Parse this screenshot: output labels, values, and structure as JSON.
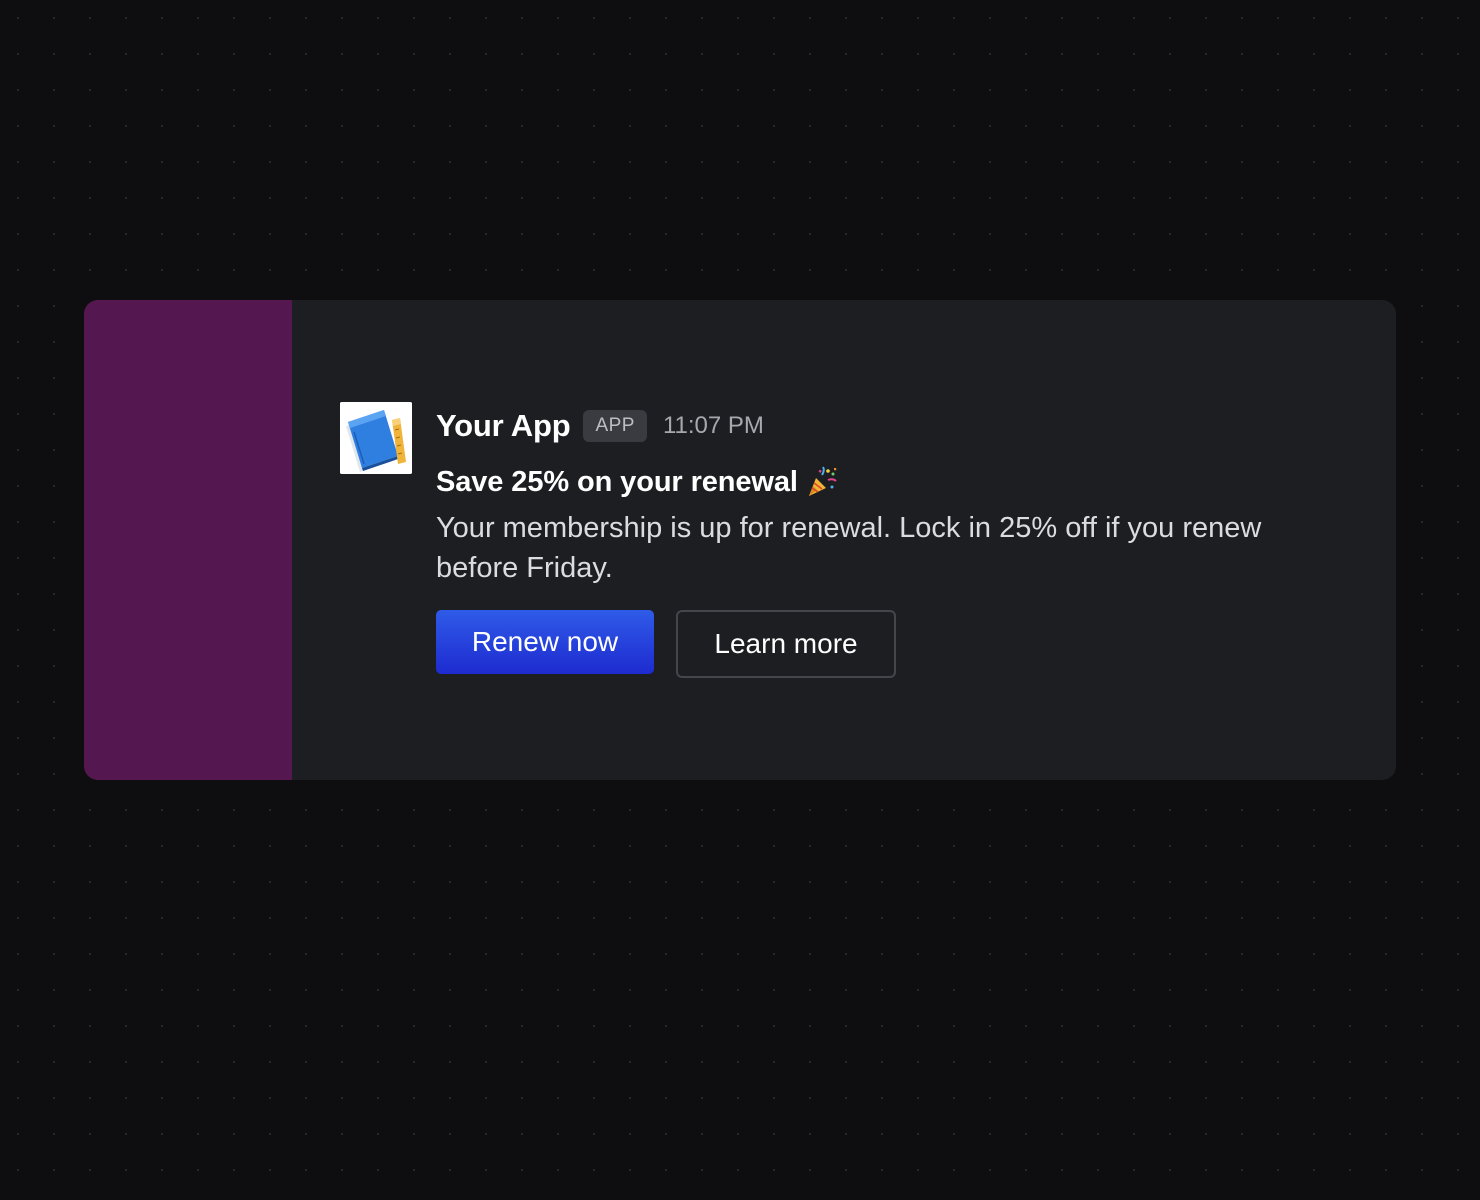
{
  "notification": {
    "app_name": "Your App",
    "app_badge": "APP",
    "timestamp": "11:07 PM",
    "title": "Save 25% on your renewal",
    "title_emoji_icon": "party-popper-icon",
    "body": "Your membership is up for renewal. Lock in 25% off if you renew before Friday.",
    "avatar_icon": "notebook-ruler-icon",
    "actions": {
      "primary_label": "Renew now",
      "secondary_label": "Learn more"
    }
  },
  "colors": {
    "page_background": "#0e0e10",
    "card_background": "#1d1e22",
    "accent_bar": "#54174f",
    "primary_button": "#2a48e0",
    "badge_background": "#3a3b40"
  }
}
